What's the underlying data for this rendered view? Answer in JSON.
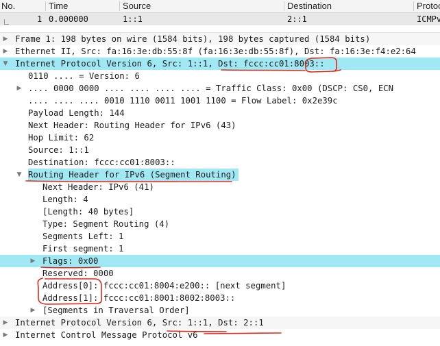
{
  "columns": {
    "no": "No.",
    "time": "Time",
    "source": "Source",
    "destination": "Destination",
    "protocol": "Protoc"
  },
  "packet": {
    "no": "1",
    "time": "0.000000",
    "source": "1::1",
    "destination": "2::1",
    "protocol": "ICMPv"
  },
  "tree": {
    "frame": "Frame 1: 198 bytes on wire (1584 bits), 198 bytes captured (1584 bits)",
    "ethernet": "Ethernet II, Src: fa:16:3e:db:55:8f (fa:16:3e:db:55:8f), Dst: fa:16:3e:f4:e2:64",
    "ipv6_a": "Internet Protocol Version 6, Src: 1::1, Dst: fccc:cc01:8003::",
    "version": "0110 .... = Version: 6",
    "traffic_class": ".... 0000 0000 .... .... .... .... = Traffic Class: 0x00 (DSCP: CS0, ECN",
    "flow_label": ".... .... .... 0010 1110 0011 1001 1100 = Flow Label: 0x2e39c",
    "payload_length": "Payload Length: 144",
    "next_header": "Next Header: Routing Header for IPv6 (43)",
    "hop_limit": "Hop Limit: 62",
    "source": "Source: 1::1",
    "destination": "Destination: fccc:cc01:8003::",
    "routing_header": "Routing Header for IPv6 (Segment Routing)",
    "rh_next_header": "Next Header: IPv6 (41)",
    "rh_length": "Length: 4",
    "rh_length_bytes": "[Length: 40 bytes]",
    "rh_type": "Type: Segment Routing (4)",
    "segments_left": "Segments Left: 1",
    "first_segment": "First segment: 1",
    "flags": "Flags: 0x00",
    "reserved": "Reserved: 0000",
    "address0": "Address[0]: fccc:cc01:8004:e200:: [next segment]",
    "address1": "Address[1]: fccc:cc01:8001:8002:8003::",
    "traversal": "[Segments in Traversal Order]",
    "ipv6_b": "Internet Protocol Version 6, Src: 1::1, Dst: 2::1",
    "icmpv6": "Internet Control Message Protocol v6"
  },
  "colors": {
    "highlight": "#a0e9f4",
    "annotation": "#e0261a"
  }
}
